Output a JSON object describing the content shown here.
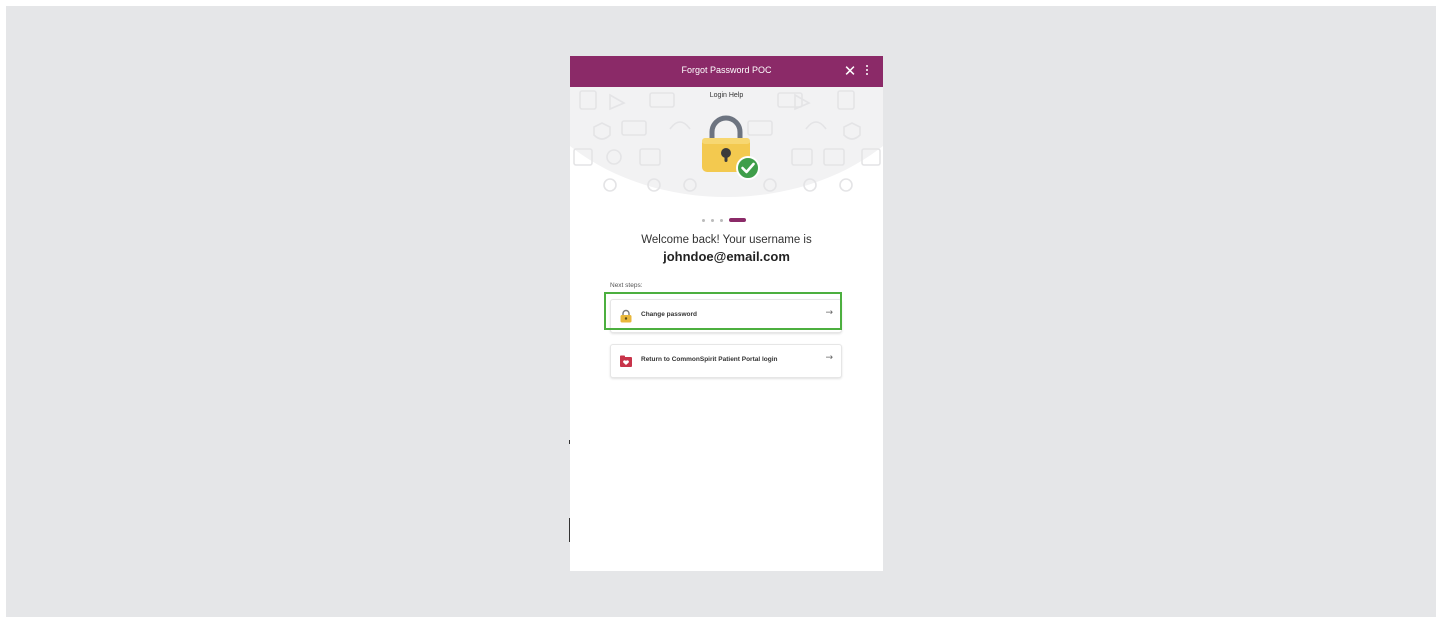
{
  "window": {
    "title": "Forgot Password POC",
    "close_icon": "close-icon",
    "menu_icon": "kebab-menu-icon"
  },
  "hero": {
    "subtitle": "Login Help",
    "illustration": "padlock-with-checkmark"
  },
  "progress": {
    "total_steps": 4,
    "current_step": 4
  },
  "message": {
    "welcome": "Welcome back! Your username is",
    "username": "johndoe@email.com"
  },
  "next_steps": {
    "label": "Next steps:",
    "options": [
      {
        "label": "Change password",
        "icon": "lock-icon",
        "arrow": "→"
      },
      {
        "label": "Return to CommonSpirit Patient Portal login",
        "icon": "portal-icon",
        "arrow": "→"
      }
    ]
  },
  "colors": {
    "brand": "#8b2a68",
    "highlight": "#4caf3f",
    "lock_body": "#f3c94f",
    "check": "#3f9e4a"
  }
}
